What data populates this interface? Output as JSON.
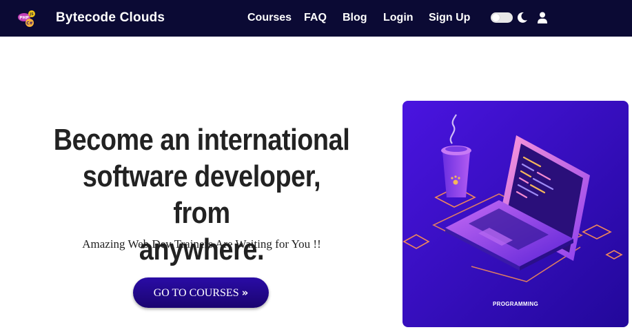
{
  "navbar": {
    "brand": "Bytecode Clouds",
    "logo_icon": "language-badges-logo",
    "links": [
      "Courses",
      "FAQ",
      "Blog",
      "Login",
      "Sign Up"
    ],
    "theme_toggle_icon": "toggle-switch",
    "moon_icon": "moon-icon",
    "user_icon": "user-icon"
  },
  "hero": {
    "headline_lines": [
      "Become an international",
      "software developer, from",
      "anywhere."
    ],
    "subline": "Amazing Web Dev Trainers Are Waiting for You !!",
    "cta_label": "GO TO COURSES",
    "cta_icon": "double-chevron-right-icon",
    "illustration_caption": "PROGRAMMING"
  },
  "colors": {
    "navbar_bg": "#0b0a34",
    "cta_bg": "#1f079a",
    "hero_bg": "#3b0fd6",
    "accent_orange": "#f08a5d"
  }
}
